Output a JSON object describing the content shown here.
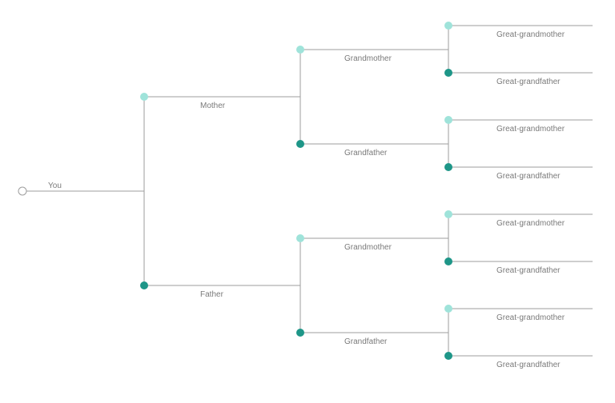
{
  "colors": {
    "node_open_fill": "#ffffff",
    "node_open_stroke": "#9e9e9e",
    "node_light": "#9fe3da",
    "node_dark": "#1e9688",
    "connector": "#9e9e9e",
    "label": "#7a7a7a"
  },
  "tree": {
    "root": {
      "label": "You"
    },
    "gen1": {
      "top": {
        "label": "Mother"
      },
      "bottom": {
        "label": "Father"
      }
    },
    "gen2": {
      "a": {
        "label": "Grandmother"
      },
      "b": {
        "label": "Grandfather"
      },
      "c": {
        "label": "Grandmother"
      },
      "d": {
        "label": "Grandfather"
      }
    },
    "gen3": {
      "a": {
        "label": "Great-grandmother"
      },
      "b": {
        "label": "Great-grandfather"
      },
      "c": {
        "label": "Great-grandmother"
      },
      "d": {
        "label": "Great-grandfather"
      },
      "e": {
        "label": "Great-grandmother"
      },
      "f": {
        "label": "Great-grandfather"
      },
      "g": {
        "label": "Great-grandmother"
      },
      "h": {
        "label": "Great-grandfather"
      }
    }
  }
}
